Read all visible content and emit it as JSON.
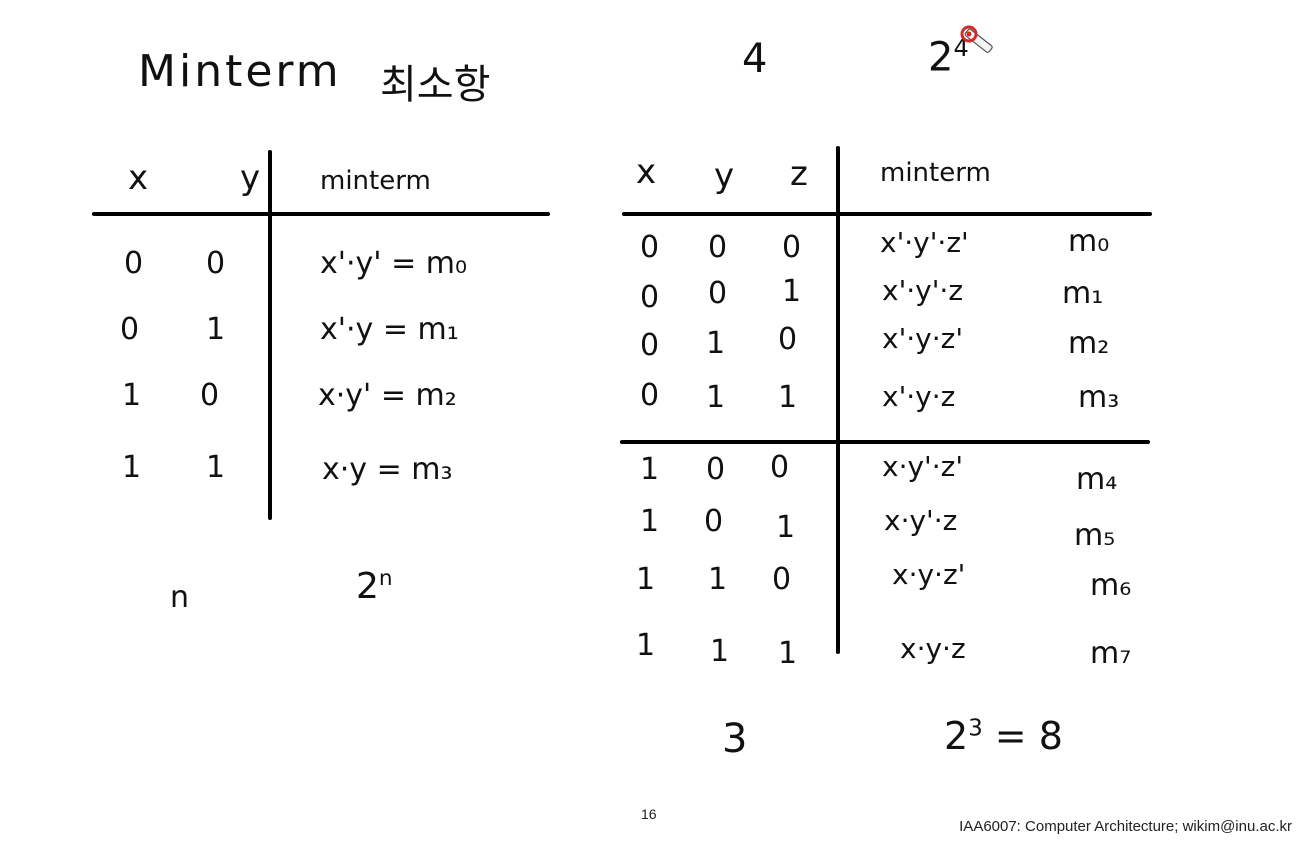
{
  "title": "Minterm",
  "title_korean": "최소항",
  "top_notes": {
    "four": "4",
    "two_power_base": "2",
    "two_power_exp": "4"
  },
  "table2": {
    "headers": [
      "x",
      "y",
      "minterm"
    ],
    "rows": [
      {
        "x": "0",
        "y": "0",
        "expr": "x'·y' = m₀"
      },
      {
        "x": "0",
        "y": "1",
        "expr": "x'·y = m₁"
      },
      {
        "x": "1",
        "y": "0",
        "expr": "x·y' = m₂"
      },
      {
        "x": "1",
        "y": "1",
        "expr": "x·y = m₃"
      }
    ],
    "bottom_n": "n",
    "bottom_base": "2",
    "bottom_exp": "n"
  },
  "table3": {
    "headers": [
      "x",
      "y",
      "z",
      "minterm"
    ],
    "rows": [
      {
        "x": "0",
        "y": "0",
        "z": "0",
        "expr": "x'·y'·z'",
        "label": "m₀"
      },
      {
        "x": "0",
        "y": "0",
        "z": "1",
        "expr": "x'·y'·z",
        "label": "m₁"
      },
      {
        "x": "0",
        "y": "1",
        "z": "0",
        "expr": "x'·y·z'",
        "label": "m₂"
      },
      {
        "x": "0",
        "y": "1",
        "z": "1",
        "expr": "x'·y·z",
        "label": "m₃"
      },
      {
        "x": "1",
        "y": "0",
        "z": "0",
        "expr": "x·y'·z'",
        "label": "m₄"
      },
      {
        "x": "1",
        "y": "0",
        "z": "1",
        "expr": "x·y'·z",
        "label": "m₅"
      },
      {
        "x": "1",
        "y": "1",
        "z": "0",
        "expr": "x·y·z'",
        "label": "m₆"
      },
      {
        "x": "1",
        "y": "1",
        "z": "1",
        "expr": "x·y·z",
        "label": "m₇"
      }
    ],
    "bottom_n": "3",
    "bottom_base": "2",
    "bottom_exp": "3",
    "bottom_rest": "= 8"
  },
  "footer": {
    "page_number": "16",
    "credit": "IAA6007: Computer Architecture; wikim@inu.ac.kr"
  },
  "icons": {
    "pen": "pen-cursor-icon"
  }
}
